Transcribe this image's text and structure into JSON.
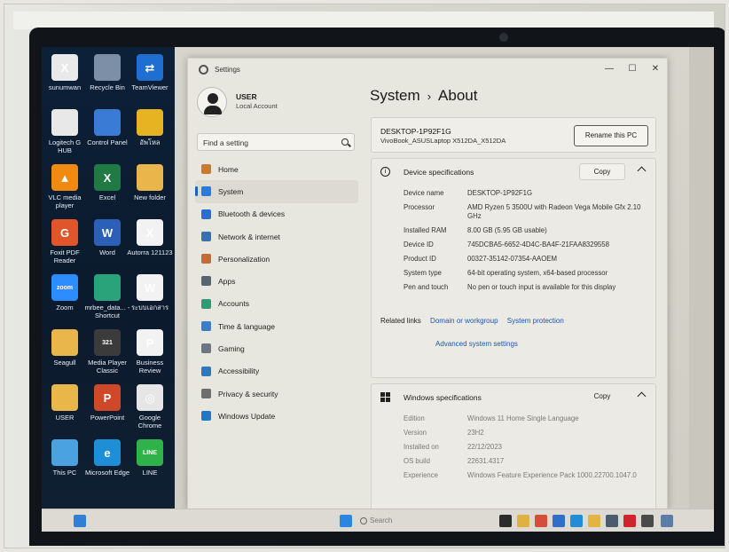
{
  "desktop": {
    "icons": [
      {
        "label": "sunumwan",
        "color": "#e9e9e9",
        "glyph": "X"
      },
      {
        "label": "Recycle Bin",
        "color": "#7d8fa6",
        "glyph": ""
      },
      {
        "label": "TeamViewer",
        "color": "#1f6fd1",
        "glyph": "⇄"
      },
      {
        "label": "Logitech G HUB",
        "color": "#e8e8e8",
        "glyph": ""
      },
      {
        "label": "Control Panel",
        "color": "#3a7bd5",
        "glyph": ""
      },
      {
        "label": "อัพโหล",
        "color": "#e6b323",
        "glyph": ""
      },
      {
        "label": "VLC media player",
        "color": "#f08a10",
        "glyph": "▲"
      },
      {
        "label": "Excel",
        "color": "#1f7a43",
        "glyph": "X"
      },
      {
        "label": "New folder",
        "color": "#e8b64a",
        "glyph": ""
      },
      {
        "label": "Foxit PDF Reader",
        "color": "#e0552a",
        "glyph": "G"
      },
      {
        "label": "Word",
        "color": "#2b5fb8",
        "glyph": "W"
      },
      {
        "label": "Autorra 121123",
        "color": "#f2f2f2",
        "glyph": "X"
      },
      {
        "label": "Zoom",
        "color": "#2d8cff",
        "glyph": "zoom"
      },
      {
        "label": "mrbee_data... - Shortcut",
        "color": "#2aa37a",
        "glyph": ""
      },
      {
        "label": "ระบบเอกสาร",
        "color": "#f2f2f2",
        "glyph": "W"
      },
      {
        "label": "Seagull",
        "color": "#e8b64a",
        "glyph": ""
      },
      {
        "label": "Media Player Classic",
        "color": "#3b3b3b",
        "glyph": "321"
      },
      {
        "label": "Business Review",
        "color": "#f2f2f2",
        "glyph": "P"
      },
      {
        "label": "USER",
        "color": "#e8b64a",
        "glyph": ""
      },
      {
        "label": "PowerPoint",
        "color": "#d0482a",
        "glyph": "P"
      },
      {
        "label": "Google Chrome",
        "color": "#e6e6e6",
        "glyph": "◎"
      },
      {
        "label": "This PC",
        "color": "#4aa3e0",
        "glyph": ""
      },
      {
        "label": "Microsoft Edge",
        "color": "#1e8ed6",
        "glyph": "e"
      },
      {
        "label": "LINE",
        "color": "#2fb24a",
        "glyph": "LINE"
      }
    ]
  },
  "settings": {
    "app_title": "Settings",
    "window_controls": {
      "minimize": "—",
      "maximize": "☐",
      "close": "✕"
    },
    "user": {
      "name": "USER",
      "account_type": "Local Account"
    },
    "search": {
      "placeholder": "Find a setting"
    },
    "nav": [
      {
        "label": "Home",
        "color": "#c77b2e",
        "active": false
      },
      {
        "label": "System",
        "color": "#2a7ad8",
        "active": true
      },
      {
        "label": "Bluetooth & devices",
        "color": "#2a6fd0",
        "active": false
      },
      {
        "label": "Network & internet",
        "color": "#3b6fb0",
        "active": false
      },
      {
        "label": "Personalization",
        "color": "#c76a35",
        "active": false
      },
      {
        "label": "Apps",
        "color": "#566472",
        "active": false
      },
      {
        "label": "Accounts",
        "color": "#2f9a73",
        "active": false
      },
      {
        "label": "Time & language",
        "color": "#3d7cc6",
        "active": false
      },
      {
        "label": "Gaming",
        "color": "#6b7682",
        "active": false
      },
      {
        "label": "Accessibility",
        "color": "#2f78c0",
        "active": false
      },
      {
        "label": "Privacy & security",
        "color": "#6e6e6e",
        "active": false
      },
      {
        "label": "Windows Update",
        "color": "#1e78c8",
        "active": false
      }
    ],
    "page": {
      "section": "System",
      "separator": "›",
      "title": "About"
    },
    "device": {
      "name": "DESKTOP-1P92F1G",
      "model": "VivoBook_ASUSLaptop X512DA_X512DA",
      "rename_label": "Rename this PC"
    },
    "device_specs": {
      "title": "Device specifications",
      "copy_label": "Copy",
      "rows": [
        {
          "k": "Device name",
          "v": "DESKTOP-1P92F1G"
        },
        {
          "k": "Processor",
          "v": "AMD Ryzen 5 3500U with Radeon Vega Mobile Gfx     2.10 GHz"
        },
        {
          "k": "Installed RAM",
          "v": "8.00 GB (5.95 GB usable)"
        },
        {
          "k": "Device ID",
          "v": "745DCBA5-6652-4D4C-BA4F-21FAA8329558"
        },
        {
          "k": "Product ID",
          "v": "00327-35142-07354-AAOEM"
        },
        {
          "k": "System type",
          "v": "64-bit operating system, x64-based processor"
        },
        {
          "k": "Pen and touch",
          "v": "No pen or touch input is available for this display"
        }
      ],
      "related_label": "Related links",
      "related_links": [
        "Domain or workgroup",
        "System protection"
      ],
      "advanced_link": "Advanced system settings"
    },
    "windows_specs": {
      "title": "Windows specifications",
      "copy_label": "Copy",
      "rows": [
        {
          "k": "Edition",
          "v": "Windows 11 Home Single Language"
        },
        {
          "k": "Version",
          "v": "23H2"
        },
        {
          "k": "Installed on",
          "v": "22/12/2023"
        },
        {
          "k": "OS build",
          "v": "22631.4317"
        },
        {
          "k": "Experience",
          "v": "Windows Feature Experience Pack 1000.22700.1047.0"
        }
      ]
    }
  },
  "taskbar": {
    "search_placeholder": "Search",
    "icons": [
      {
        "name": "widgets-icon",
        "color": "#2f7fd6"
      },
      {
        "name": "start-icon",
        "color": "#2a86e0"
      },
      {
        "name": "terminal-icon",
        "color": "#2b2b2b"
      },
      {
        "name": "file-explorer-icon",
        "color": "#e0b040"
      },
      {
        "name": "chrome-icon",
        "color": "#d34f3c"
      },
      {
        "name": "mail-icon",
        "color": "#2f6fc7"
      },
      {
        "name": "edge-icon",
        "color": "#1f8ed6"
      },
      {
        "name": "folder-icon",
        "color": "#e3b43f"
      },
      {
        "name": "store-icon",
        "color": "#4a5b6e"
      },
      {
        "name": "opera-icon",
        "color": "#d1232a"
      },
      {
        "name": "files-icon",
        "color": "#4a4a4a"
      },
      {
        "name": "settings-icon",
        "color": "#5b7da8"
      }
    ]
  }
}
